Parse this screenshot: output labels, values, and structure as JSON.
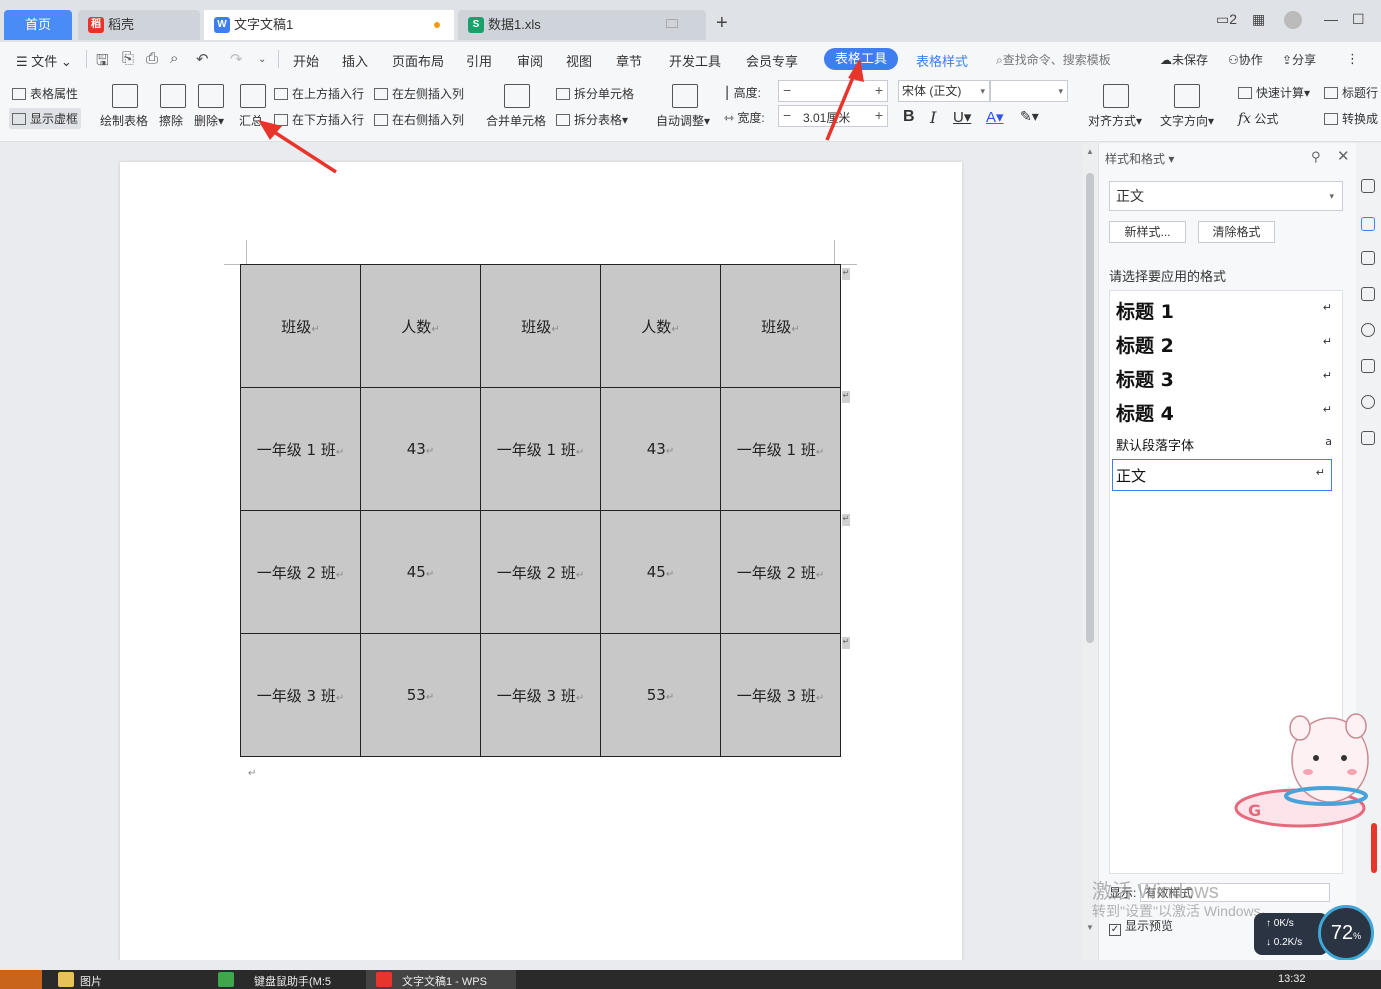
{
  "tabs": {
    "home": "首页",
    "docer": "稻壳",
    "doc1": "文字文稿1",
    "data1": "数据1.xls"
  },
  "menu": {
    "file": "文件",
    "items": [
      "开始",
      "插入",
      "页面布局",
      "引用",
      "审阅",
      "视图",
      "章节",
      "开发工具",
      "会员专享"
    ],
    "table_tools": "表格工具",
    "table_style": "表格样式",
    "search": "查找命令、搜索模板",
    "unsaved": "未保存",
    "collab": "协作",
    "share": "分享"
  },
  "ribbon": {
    "table_props": "表格属性",
    "show_gridlines": "显示虚框",
    "draw_table": "绘制表格",
    "erase": "擦除",
    "delete": "删除",
    "summary": "汇总",
    "insert_above": "在上方插入行",
    "insert_below": "在下方插入行",
    "insert_left": "在左侧插入列",
    "insert_right": "在右侧插入列",
    "merge_cells": "合并单元格",
    "split_cells": "拆分单元格",
    "split_table": "拆分表格",
    "auto_fit": "自动调整",
    "height_label": "高度:",
    "height_value": "",
    "width_label": "宽度:",
    "width_value": "3.01厘米",
    "font_name": "宋体 (正文)",
    "font_size": "",
    "align": "对齐方式",
    "text_dir": "文字方向",
    "quick_calc": "快速计算",
    "title_row": "标题行",
    "formula": "公式",
    "convert": "转换成"
  },
  "table": {
    "rows": [
      [
        "班级",
        "人数",
        "班级",
        "人数",
        "班级"
      ],
      [
        "一年级 1 班",
        "43",
        "一年级 1 班",
        "43",
        "一年级 1 班"
      ],
      [
        "一年级 2 班",
        "45",
        "一年级 2 班",
        "45",
        "一年级 2 班"
      ],
      [
        "一年级 3 班",
        "53",
        "一年级 3 班",
        "53",
        "一年级 3 班"
      ]
    ]
  },
  "styles_panel": {
    "title": "样式和格式",
    "current_style": "正文",
    "new_style": "新样式...",
    "clear_format": "清除格式",
    "choose_label": "请选择要应用的格式",
    "items": [
      {
        "label": "标题  1",
        "mark": "↵"
      },
      {
        "label": "标题  2",
        "mark": "↵"
      },
      {
        "label": "标题  3",
        "mark": "↵"
      },
      {
        "label": "标题  4",
        "mark": "↵"
      },
      {
        "label": "默认段落字体",
        "mark": "a"
      },
      {
        "label": "正文",
        "mark": "↵"
      }
    ],
    "show_label": "显示:",
    "show_value": "有效样式",
    "preview_label": "显示预览"
  },
  "watermark": {
    "line1": "激活 Windows",
    "line2": "转到\"设置\"以激活 Windows。"
  },
  "speed": {
    "up": "0K/s",
    "down": "0.2K/s",
    "percent": "72"
  },
  "taskbar": {
    "item1": "图片",
    "item2": "键盘鼠助手(M:5",
    "item3": "文字文稿1 - WPS",
    "time": "13:32"
  },
  "colors": {
    "accent": "#3e7ef0",
    "cell_fill": "#c8c8c8",
    "arrow": "#e8352b"
  }
}
